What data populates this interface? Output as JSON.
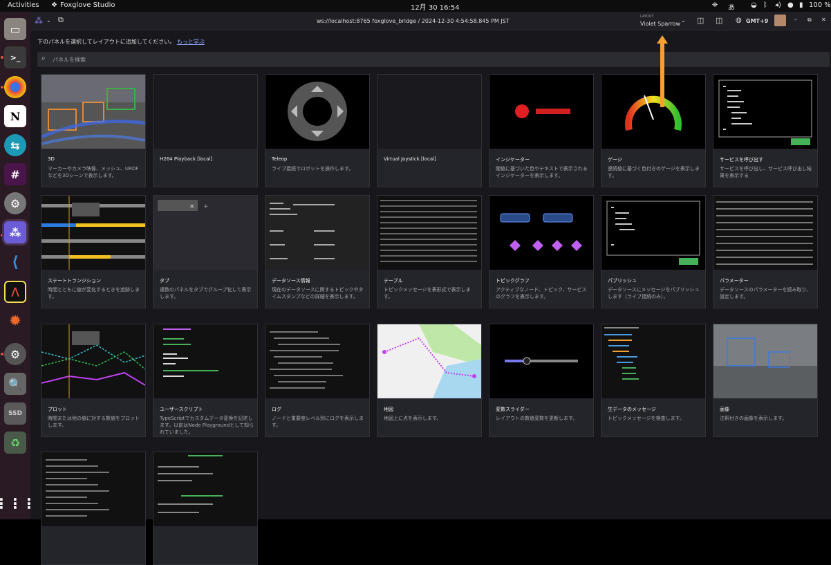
{
  "topbar": {
    "activities": "Activities",
    "app_name": "Foxglove Studio",
    "datetime": "12月 30 16:54",
    "input_method": "あ",
    "battery": "100 %"
  },
  "header": {
    "title": "ws://localhost:8765 foxglove_bridge / 2024-12-30 4:54:58.845 PM JST",
    "layout_label": "LAYOUT",
    "layout_name": "Violet Sparrow",
    "timezone": "GMT+9"
  },
  "panel_picker": {
    "hint": "下のパネルを選択してレイアウトに追加してください。",
    "learn_more": "もっと学ぶ",
    "search_placeholder": "パネルを検索"
  },
  "panels": [
    {
      "id": "3d",
      "title": "3D",
      "description": "マーカーやカメラ映像、メッシュ、URDFなどを3Dシーンで表示します。"
    },
    {
      "id": "h264",
      "title": "H264 Playback [local]",
      "description": ""
    },
    {
      "id": "teleop",
      "title": "Teleop",
      "description": "ライブ接続でロボットを操作します。"
    },
    {
      "id": "joystick",
      "title": "Virtual Joystick [local]",
      "description": ""
    },
    {
      "id": "indicator",
      "title": "インジケーター",
      "description": "閾値に基づいた色やテキストで表示されるインジケーターを表示します。"
    },
    {
      "id": "gauge",
      "title": "ゲージ",
      "description": "連続値に基づく色付きのゲージを表示します。"
    },
    {
      "id": "service",
      "title": "サービスを呼び出す",
      "description": "サービスを呼び出し、サービス呼び出し結果を表示する"
    },
    {
      "id": "state",
      "title": "ステートトランジション",
      "description": "時間とともに値が変化するときを追跡します。"
    },
    {
      "id": "tab",
      "title": "タブ",
      "description": "複数のパネルをタブでグループ化して表示します。"
    },
    {
      "id": "datasource",
      "title": "データソース情報",
      "description": "現在のデータソースに関するトピックやタイムスタンプなどの詳細を表示します。"
    },
    {
      "id": "table",
      "title": "テーブル",
      "description": "トピックメッセージを表形式で表示します。"
    },
    {
      "id": "graph",
      "title": "トピックグラフ",
      "description": "アクティブなノード、トピック、サービスのグラフを表示します。"
    },
    {
      "id": "publish",
      "title": "パブリッシュ",
      "description": "データソースにメッセージをパブリッシュします（ライブ接続のみ）。"
    },
    {
      "id": "params",
      "title": "パラメーター",
      "description": "データソースのパラメーターを読み取り、設定します。"
    },
    {
      "id": "plot",
      "title": "プロット",
      "description": "時間または他の値に対する数値をプロットします。"
    },
    {
      "id": "userscript",
      "title": "ユーザースクリプト",
      "description": "TypeScriptでカスタムデータ変換を記述します。以前はNode Playgroundとして知られていました。"
    },
    {
      "id": "log",
      "title": "ログ",
      "description": "ノードと重要度レベル別にログを表示します。"
    },
    {
      "id": "map",
      "title": "地図",
      "description": "地図上に点を表示します。"
    },
    {
      "id": "slider",
      "title": "変数スライダー",
      "description": "レイアウトの数値変数を更新します。"
    },
    {
      "id": "rawmsg",
      "title": "生データのメッセージ",
      "description": "トピックメッセージを検査します。"
    },
    {
      "id": "image",
      "title": "画像",
      "description": "注釈付きの画像を表示します。"
    },
    {
      "id": "more1",
      "title": "",
      "description": ""
    },
    {
      "id": "more2",
      "title": "",
      "description": ""
    }
  ],
  "colors": {
    "accent": "#8fa6ff",
    "arrow": "#f5a030",
    "green": "#45b25a"
  }
}
